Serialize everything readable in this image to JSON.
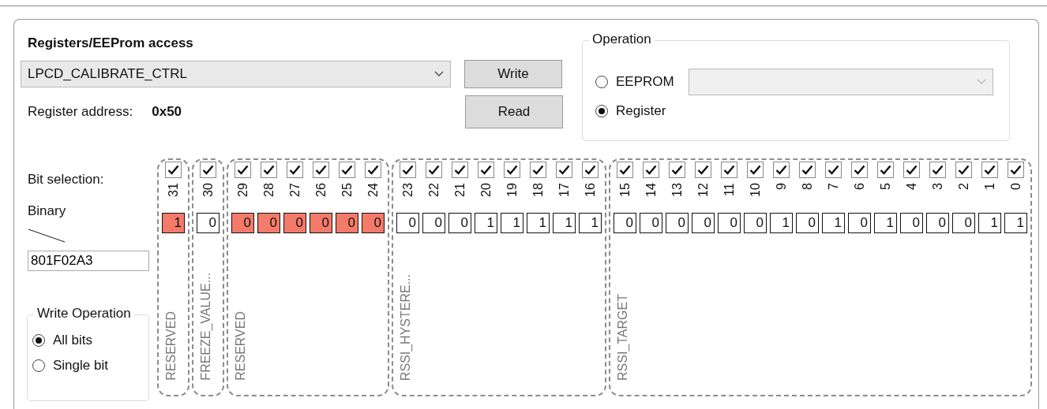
{
  "section_title": "Registers/EEProm access",
  "register_select": {
    "value": "LPCD_CALIBRATE_CTRL"
  },
  "buttons": [
    {
      "label": "Write"
    },
    {
      "label": "Read"
    }
  ],
  "register_address": {
    "label": "Register address:",
    "value": "0x50"
  },
  "operation": {
    "title": "Operation",
    "options": [
      {
        "label": "EEPROM",
        "selected": false
      },
      {
        "label": "Register",
        "selected": true
      }
    ],
    "eeprom_select": {
      "disabled": true
    }
  },
  "bit_selection_label": "Bit selection:",
  "binary_label": "Binary",
  "hex_value": "801F02A3",
  "write_operation": {
    "title": "Write Operation",
    "options": [
      {
        "label": "All bits",
        "selected": true
      },
      {
        "label": "Single bit",
        "selected": false
      }
    ]
  },
  "fields": [
    {
      "name": "RESERVED",
      "bits": [
        {
          "number": "31",
          "value": "1",
          "checked": true,
          "highlighted": true
        }
      ]
    },
    {
      "name": "FREEZE_VALUE...",
      "bits": [
        {
          "number": "30",
          "value": "0",
          "checked": true,
          "highlighted": false
        }
      ]
    },
    {
      "name": "RESERVED",
      "bits": [
        {
          "number": "29",
          "value": "0",
          "checked": true,
          "highlighted": true
        },
        {
          "number": "28",
          "value": "0",
          "checked": true,
          "highlighted": true
        },
        {
          "number": "27",
          "value": "0",
          "checked": true,
          "highlighted": true
        },
        {
          "number": "26",
          "value": "0",
          "checked": true,
          "highlighted": true
        },
        {
          "number": "25",
          "value": "0",
          "checked": true,
          "highlighted": true
        },
        {
          "number": "24",
          "value": "0",
          "checked": true,
          "highlighted": true
        }
      ]
    },
    {
      "name": "RSSI_HYSTERE...",
      "bits": [
        {
          "number": "23",
          "value": "0",
          "checked": true,
          "highlighted": false
        },
        {
          "number": "22",
          "value": "0",
          "checked": true,
          "highlighted": false
        },
        {
          "number": "21",
          "value": "0",
          "checked": true,
          "highlighted": false
        },
        {
          "number": "20",
          "value": "1",
          "checked": true,
          "highlighted": false
        },
        {
          "number": "19",
          "value": "1",
          "checked": true,
          "highlighted": false
        },
        {
          "number": "18",
          "value": "1",
          "checked": true,
          "highlighted": false
        },
        {
          "number": "17",
          "value": "1",
          "checked": true,
          "highlighted": false
        },
        {
          "number": "16",
          "value": "1",
          "checked": true,
          "highlighted": false
        }
      ]
    },
    {
      "name": "RSSI_TARGET",
      "bits": [
        {
          "number": "15",
          "value": "0",
          "checked": true,
          "highlighted": false
        },
        {
          "number": "14",
          "value": "0",
          "checked": true,
          "highlighted": false
        },
        {
          "number": "13",
          "value": "0",
          "checked": true,
          "highlighted": false
        },
        {
          "number": "12",
          "value": "0",
          "checked": true,
          "highlighted": false
        },
        {
          "number": "11",
          "value": "0",
          "checked": true,
          "highlighted": false
        },
        {
          "number": "10",
          "value": "0",
          "checked": true,
          "highlighted": false
        },
        {
          "number": "9",
          "value": "1",
          "checked": true,
          "highlighted": false
        },
        {
          "number": "8",
          "value": "0",
          "checked": true,
          "highlighted": false
        },
        {
          "number": "7",
          "value": "1",
          "checked": true,
          "highlighted": false
        },
        {
          "number": "6",
          "value": "0",
          "checked": true,
          "highlighted": false
        },
        {
          "number": "5",
          "value": "1",
          "checked": true,
          "highlighted": false
        },
        {
          "number": "4",
          "value": "0",
          "checked": true,
          "highlighted": false
        },
        {
          "number": "3",
          "value": "0",
          "checked": true,
          "highlighted": false
        },
        {
          "number": "2",
          "value": "0",
          "checked": true,
          "highlighted": false
        },
        {
          "number": "1",
          "value": "1",
          "checked": true,
          "highlighted": false
        },
        {
          "number": "0",
          "value": "1",
          "checked": true,
          "highlighted": false
        }
      ]
    }
  ]
}
